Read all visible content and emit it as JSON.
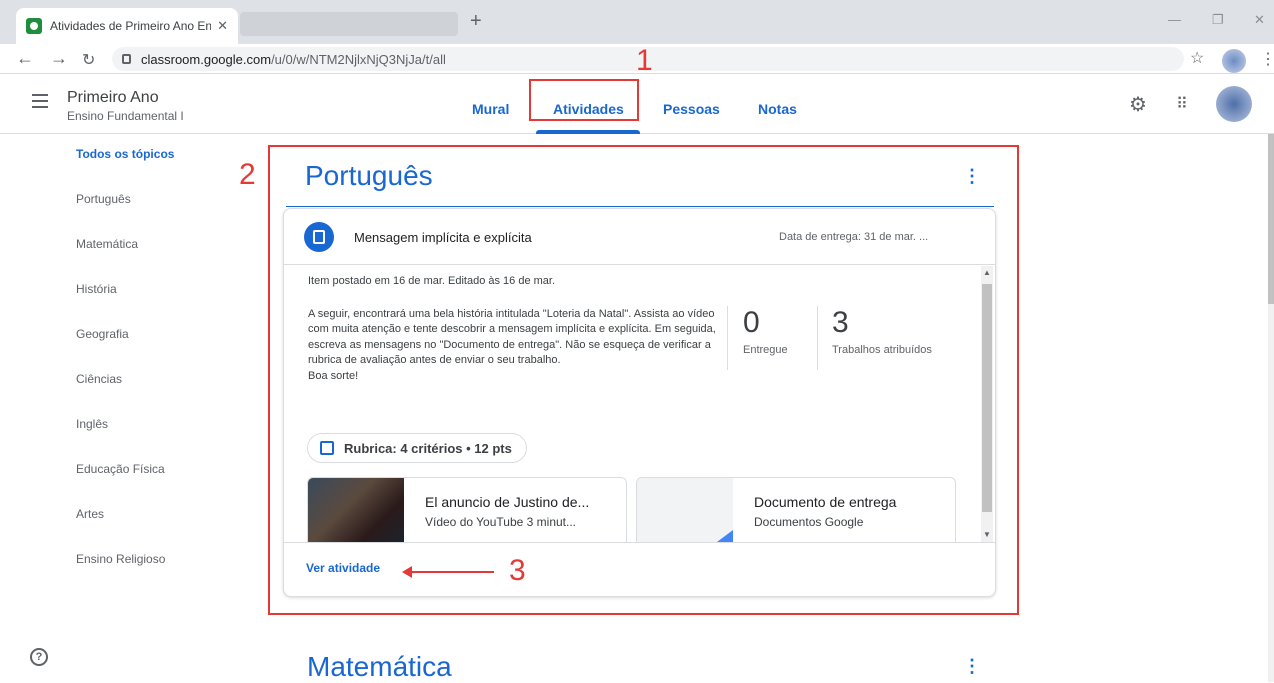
{
  "browser": {
    "tab_title": "Atividades de Primeiro Ano Ensir",
    "url_host": "classroom.google.com",
    "url_path": "/u/0/w/NTM2NjlxNjQ3NjJa/t/all"
  },
  "header": {
    "class_name": "Primeiro Ano",
    "class_section": "Ensino Fundamental I",
    "tabs": [
      {
        "label": "Mural"
      },
      {
        "label": "Atividades"
      },
      {
        "label": "Pessoas"
      },
      {
        "label": "Notas"
      }
    ]
  },
  "sidebar": {
    "items": [
      {
        "label": "Todos os tópicos"
      },
      {
        "label": "Português"
      },
      {
        "label": "Matemática"
      },
      {
        "label": "História"
      },
      {
        "label": "Geografia"
      },
      {
        "label": "Ciências"
      },
      {
        "label": "Inglês"
      },
      {
        "label": "Educação Física"
      },
      {
        "label": "Artes"
      },
      {
        "label": "Ensino Religioso"
      }
    ]
  },
  "annotations": {
    "n1": "1",
    "n2": "2",
    "n3": "3"
  },
  "topic": {
    "title": "Português",
    "assignment": {
      "title": "Mensagem implícita e explícita",
      "due": "Data de entrega: 31 de mar. ...",
      "posted": "Item postado em 16 de mar. Editado às 16 de mar.",
      "description": [
        "A seguir, encontrará uma bela história intitulada \"Loteria da Natal\". Assista ao vídeo com muita atenção e tente descobrir a mensagem implícita e explícita. Em seguida, escreva as mensagens no \"Documento de entrega\". Não se esqueça de verificar a rubrica de avaliação antes de enviar o seu trabalho.",
        "Boa sorte!"
      ],
      "stats": [
        {
          "value": "0",
          "label": "Entregue"
        },
        {
          "value": "3",
          "label": "Trabalhos atribuídos"
        }
      ],
      "rubric": "Rubrica: 4 critérios • 12 pts",
      "attachments": [
        {
          "title": "El anuncio de Justino de...",
          "subtitle": "Vídeo do YouTube   3 minut..."
        },
        {
          "title": "Documento de entrega",
          "subtitle": "Documentos Google"
        }
      ],
      "view_link": "Ver atividade"
    }
  },
  "next_topic": {
    "title": "Matemática"
  },
  "colors": {
    "accent": "#1967d2",
    "annotation": "#e53935"
  }
}
